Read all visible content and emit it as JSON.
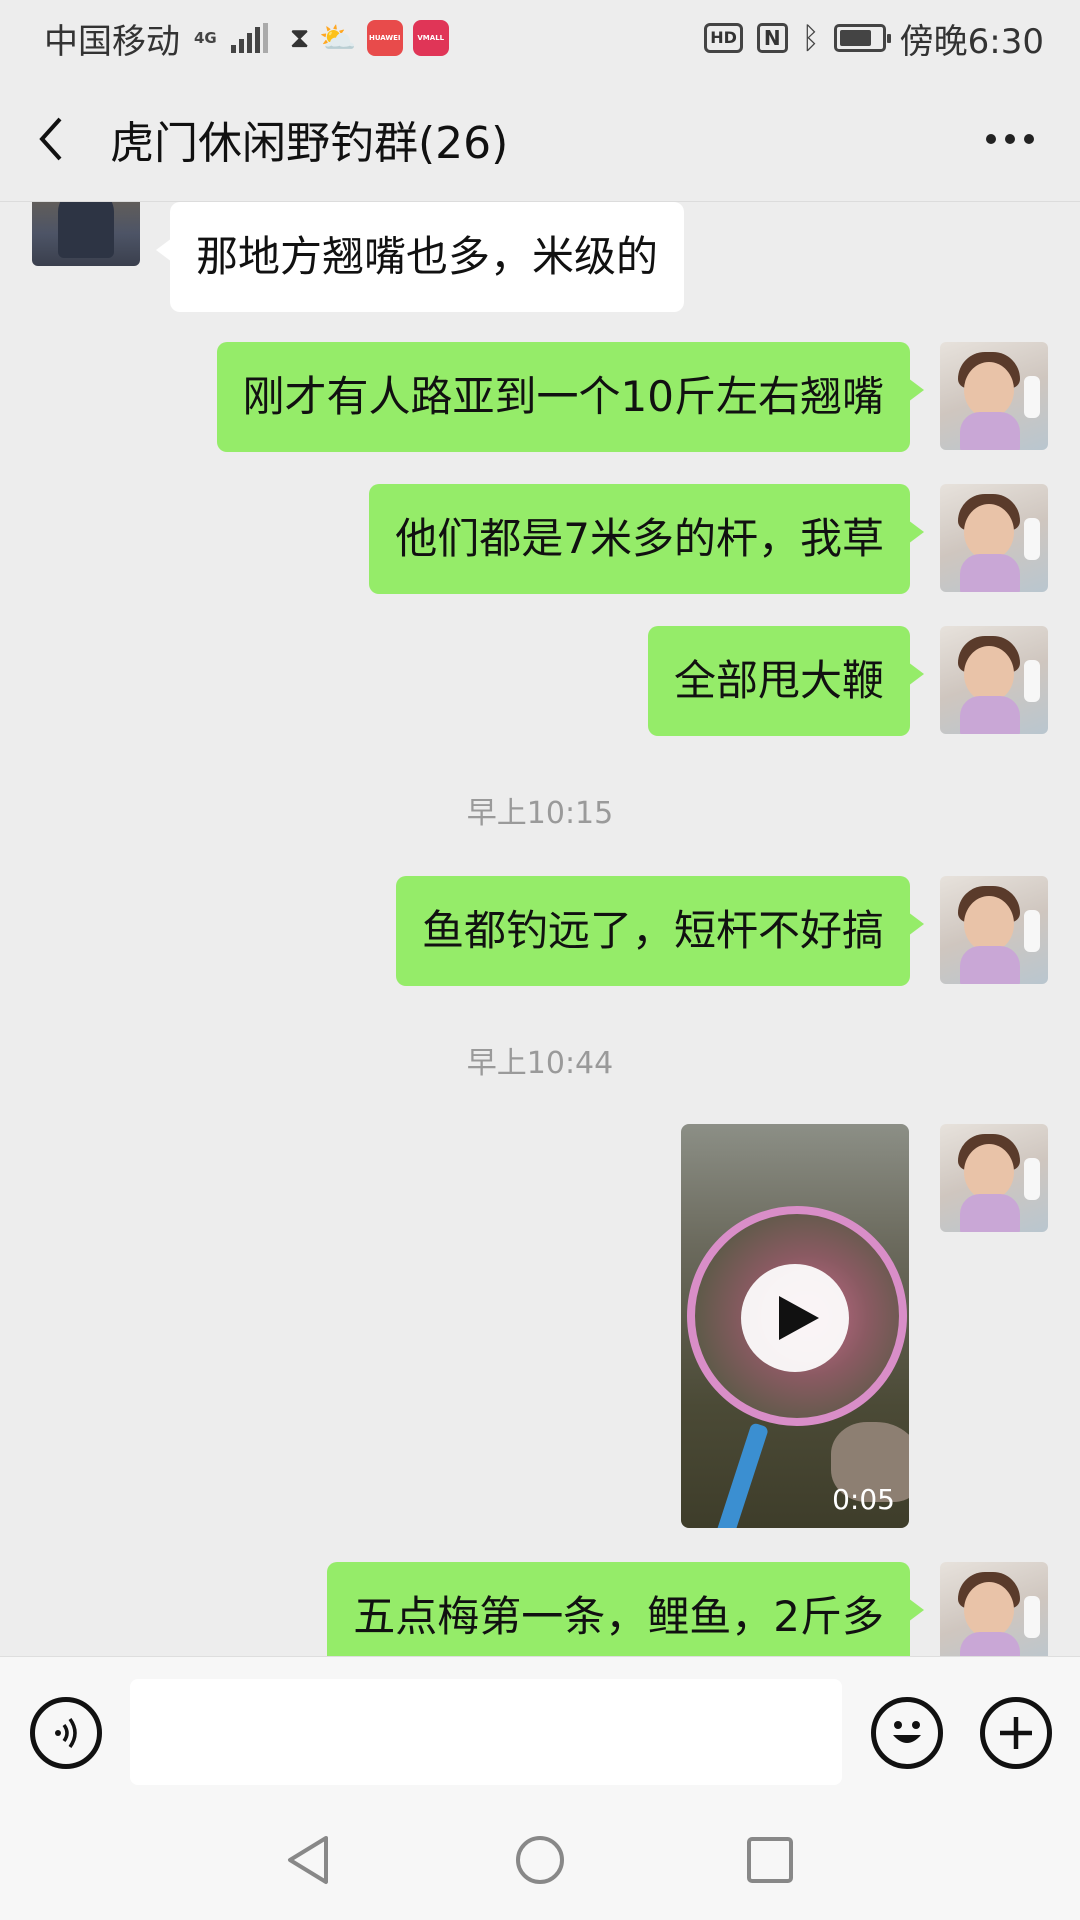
{
  "status_bar": {
    "carrier": "中国移动",
    "network": "4G",
    "app1": "HUAWEI",
    "app2": "VMALL",
    "hd": "HD",
    "nfc": "N",
    "time": "傍晚6:30"
  },
  "header": {
    "title": "虎门休闲野钓群(26)"
  },
  "messages": [
    {
      "sender": "other",
      "text": "那地方翘嘴也多，米级的"
    },
    {
      "sender": "me",
      "text": "刚才有人路亚到一个10斤左右翘嘴"
    },
    {
      "sender": "me",
      "text": "他们都是7米多的杆，我草"
    },
    {
      "sender": "me",
      "text": "全部甩大鞭"
    },
    {
      "type": "time",
      "text": "早上10:15"
    },
    {
      "sender": "me",
      "text": "鱼都钓远了，短杆不好搞"
    },
    {
      "type": "time",
      "text": "早上10:44"
    },
    {
      "sender": "me",
      "type": "video",
      "duration": "0:05"
    },
    {
      "sender": "me",
      "text": "五点梅第一条，鲤鱼，2斤多"
    }
  ],
  "input_bar": {
    "placeholder": ""
  },
  "colors": {
    "my_bubble": "#95ec69",
    "other_bubble": "#ffffff",
    "background": "#ededed"
  }
}
